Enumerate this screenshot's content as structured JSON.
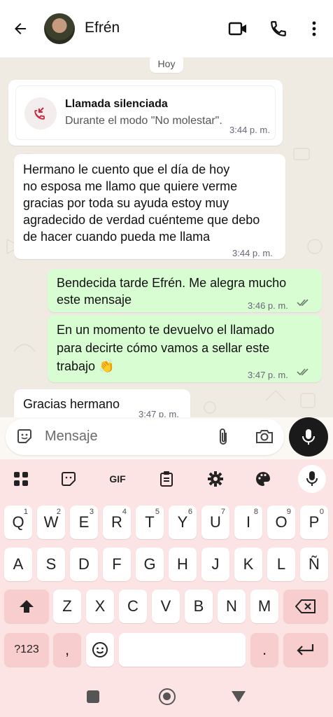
{
  "header": {
    "contact_name": "Efrén"
  },
  "chat": {
    "day_label": "Hoy",
    "call_card": {
      "title": "Llamada silenciada",
      "subtitle": "Durante el modo \"No molestar\".",
      "time": "3:44 p. m."
    },
    "messages": [
      {
        "dir": "in",
        "lines": [
          "Hermano le cuento que el día de hoy",
          "no esposa me llamo que quiere verme",
          "gracias por toda su ayuda estoy muy",
          "agradecido de verdad cuénteme que debo",
          "de hacer cuando pueda me llama"
        ],
        "time": "3:44 p. m."
      },
      {
        "dir": "out",
        "lines": [
          "Bendecida tarde Efrén. Me alegra mucho",
          "este mensaje"
        ],
        "time": "3:46 p. m."
      },
      {
        "dir": "out",
        "lines": [
          "En un momento te devuelvo el llamado",
          "para decirte cómo vamos a sellar este",
          "trabajo 👏"
        ],
        "time": "3:47 p. m."
      },
      {
        "dir": "in",
        "lines": [
          "Gracias hermano"
        ],
        "time": "3:47 p. m."
      }
    ]
  },
  "composer": {
    "placeholder": "Mensaje"
  },
  "keyboard": {
    "toolbar": {
      "gif_label": "GIF"
    },
    "row1": [
      [
        "Q",
        "1"
      ],
      [
        "W",
        "2"
      ],
      [
        "E",
        "3"
      ],
      [
        "R",
        "4"
      ],
      [
        "T",
        "5"
      ],
      [
        "Y",
        "6"
      ],
      [
        "U",
        "7"
      ],
      [
        "I",
        "8"
      ],
      [
        "O",
        "9"
      ],
      [
        "P",
        "0"
      ]
    ],
    "row2": [
      "A",
      "S",
      "D",
      "F",
      "G",
      "H",
      "J",
      "K",
      "L",
      "Ñ"
    ],
    "row3": [
      "Z",
      "X",
      "C",
      "V",
      "B",
      "N",
      "M"
    ],
    "row4": {
      "symbols": "?123",
      "comma": ",",
      "period": "."
    }
  }
}
